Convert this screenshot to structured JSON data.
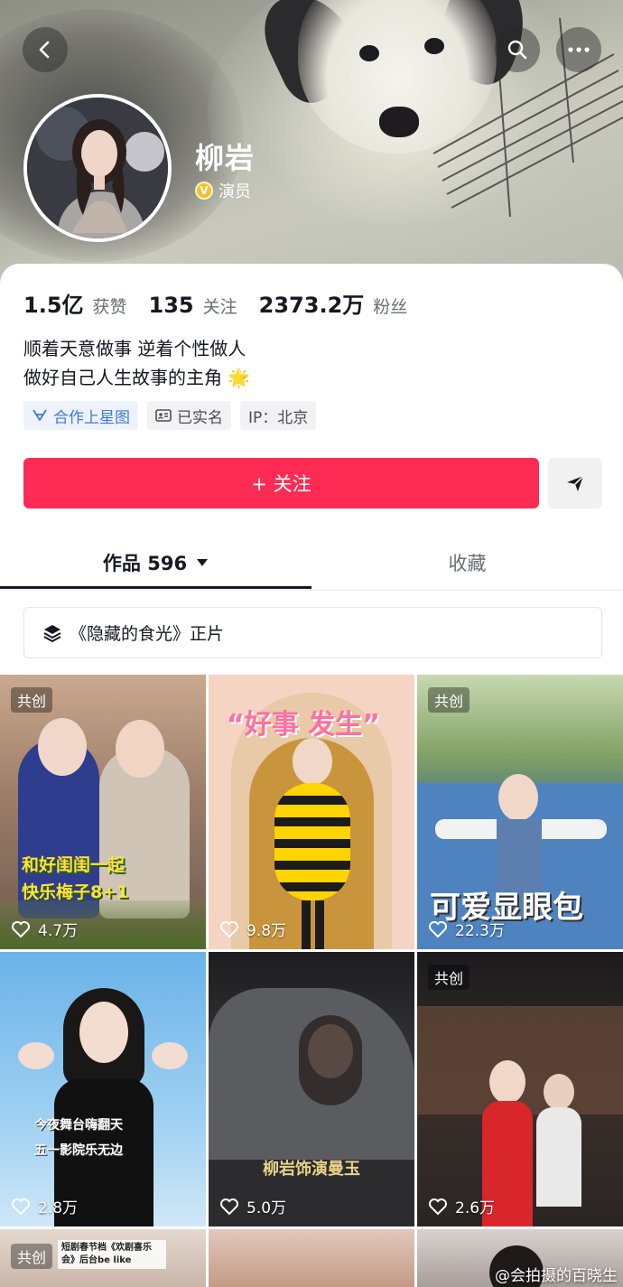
{
  "profile": {
    "name": "柳岩",
    "role": "演员",
    "badge_letter": "V"
  },
  "stats": [
    {
      "value": "1.5亿",
      "label": "获赞"
    },
    {
      "value": "135",
      "label": "关注"
    },
    {
      "value": "2373.2万",
      "label": "粉丝"
    }
  ],
  "bio": {
    "line1": "顺着天意做事 逆着个性做人",
    "line2": "做好自己人生故事的主角",
    "line2_emoji": "🌟"
  },
  "tags": [
    {
      "label": "合作上星图",
      "icon": "star-map-icon"
    },
    {
      "label": "已实名",
      "icon": "id-card-icon"
    },
    {
      "label": "IP：北京",
      "icon": ""
    }
  ],
  "actions": {
    "follow_label": "+ 关注",
    "share_icon": "send-icon"
  },
  "tabs": {
    "works_label": "作品 596",
    "favorites_label": "收藏"
  },
  "collection": {
    "label": "《隐藏的食光》正片",
    "icon": "layers-icon"
  },
  "videos": [
    {
      "likes": "4.7万",
      "badge": "共创",
      "overlay": "和好闺闺一起\n快乐梅子8+1"
    },
    {
      "likes": "9.8万",
      "badge": "",
      "overlay": "“好事 发生”"
    },
    {
      "likes": "22.3万",
      "badge": "共创",
      "overlay": "可爱显眼包"
    },
    {
      "likes": "2.8万",
      "badge": "",
      "overlay": "今夜舞台嗨翻天\n五一影院乐无边"
    },
    {
      "likes": "5.0万",
      "badge": "",
      "overlay": "柳岩饰演曼玉"
    },
    {
      "likes": "2.6万",
      "badge": "共创",
      "overlay": ""
    },
    {
      "likes": "",
      "badge": "共创",
      "overlay": "短剧春节档《欢剧喜乐会》后台be like"
    },
    {
      "likes": "",
      "badge": "",
      "overlay": ""
    },
    {
      "likes": "",
      "badge": "",
      "overlay": ""
    }
  ],
  "watermark": "@会拍摄的百晓生",
  "colors": {
    "accent": "#fe2c55",
    "text": "#161823",
    "secondary": "#6b6d75",
    "tag_blue": "#3c7bd6"
  }
}
